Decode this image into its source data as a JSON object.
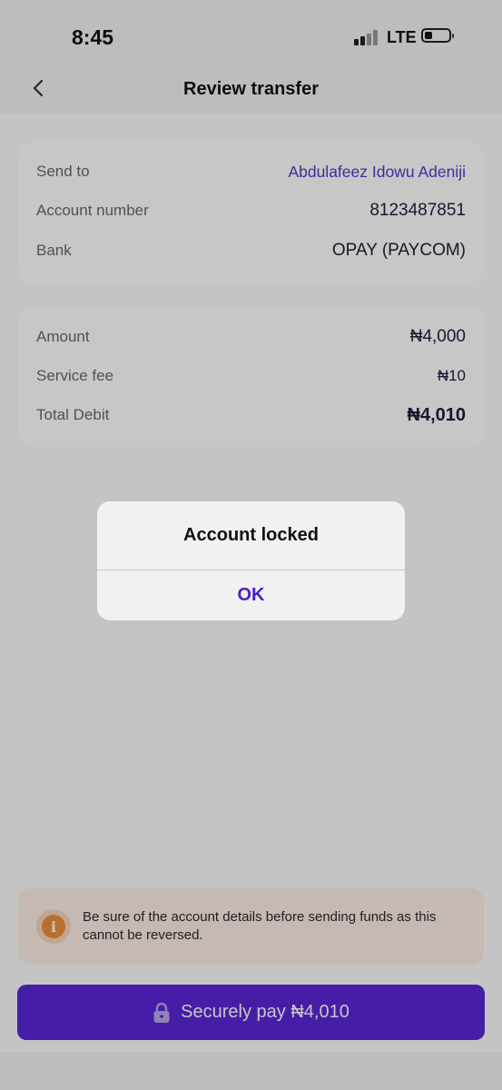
{
  "status_bar": {
    "time": "8:45",
    "network": "LTE"
  },
  "nav": {
    "title": "Review transfer",
    "back_icon": "chevron-left-icon"
  },
  "recipient_card": {
    "rows": [
      {
        "label": "Send to",
        "value": "Abdulafeez Idowu Adeniji"
      },
      {
        "label": "Account number",
        "value": "8123487851"
      },
      {
        "label": "Bank",
        "value": "OPAY (PAYCOM)"
      }
    ]
  },
  "amount_card": {
    "rows": [
      {
        "label": "Amount",
        "value": "₦4,000"
      },
      {
        "label": "Service fee",
        "value": "₦10"
      },
      {
        "label": "Total Debit",
        "value": "₦4,010"
      }
    ]
  },
  "notice": {
    "icon": "info-icon",
    "glyph": "i",
    "text": "Be sure of the account details before sending funds as this cannot be reversed."
  },
  "pay_button": {
    "icon": "lock-icon",
    "label": "Securely pay ₦4,010"
  },
  "alert": {
    "title": "Account locked",
    "ok_label": "OK"
  },
  "colors": {
    "accent": "#5a26d6",
    "recipient_name": "#5a35c8",
    "notice_bg": "#fbefe6",
    "info_icon": "#ec8f3b"
  }
}
